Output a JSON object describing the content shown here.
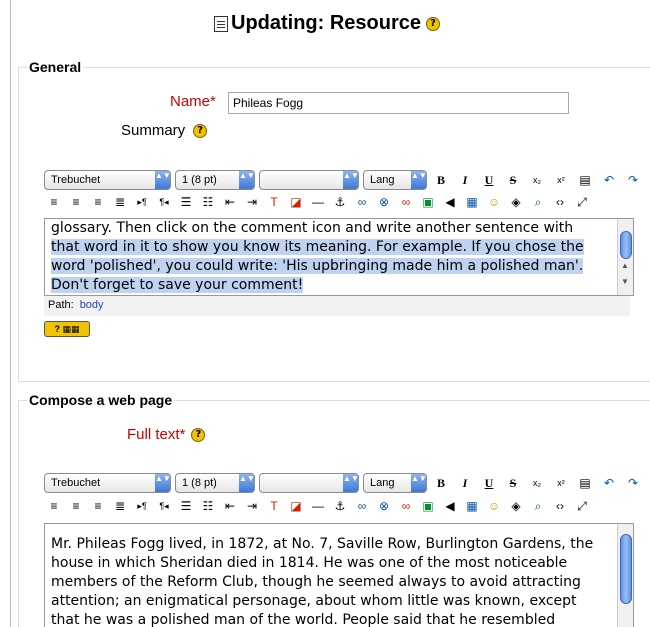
{
  "page": {
    "title": "Updating: Resource",
    "title_icon": "document-icon",
    "help_glyph": "?"
  },
  "general": {
    "legend": "General",
    "name_label": "Name",
    "required_mark": "*",
    "name_value": "Phileas Fogg",
    "summary_label": "Summary",
    "editor_text_plain": "glossary. Then click on the comment icon and write another sentence with",
    "editor_text_selected": [
      "that word in it to show you know its meaning. For example. If you chose the",
      "word 'polished', you could write: 'His upbringing made him a polished man'.",
      "Don't forget to save your comment!"
    ],
    "path_label": "Path:",
    "path_value": "body",
    "keyboard_help_icon": "keyboard-help-icon"
  },
  "compose": {
    "legend": "Compose a web page",
    "full_text_label": "Full text",
    "required_mark": "*",
    "editor_lines": [
      "Mr. Phileas Fogg lived, in 1872, at No. 7, Saville Row, Burlington Gardens, the",
      "house in which Sheridan died in 1814. He was one of the most noticeable",
      "members of the Reform Club, though he seemed always to avoid attracting",
      "attention; an enigmatical personage, about whom little was known, except",
      "that he was a polished man of the world. People said that he resembled"
    ]
  },
  "toolbar": {
    "font": "Trebuchet",
    "size": "1 (8 pt)",
    "style": "",
    "lang": "Lang",
    "bold": "B",
    "italic": "I",
    "underline": "U",
    "strike": "S",
    "subscript": "x₂",
    "superscript": "x²",
    "arrow_glyph": "▲▼",
    "row2_icons": [
      "align-left-icon",
      "align-center-icon",
      "align-right-icon",
      "align-justify-icon",
      "ltr-icon",
      "rtl-icon",
      "ordered-list-icon",
      "unordered-list-icon",
      "outdent-icon",
      "indent-icon",
      "text-color-icon",
      "background-color-icon",
      "horizontal-rule-icon",
      "anchor-icon",
      "link-icon",
      "unlink-icon",
      "nolink-icon",
      "image-icon",
      "media-icon",
      "table-icon",
      "smiley-icon",
      "special-char-icon",
      "search-replace-icon",
      "html-source-icon",
      "fullscreen-icon"
    ]
  },
  "colors": {
    "required": "#cc0000",
    "selection": "#bdd3f0",
    "help_icon": "#f2c400",
    "path_link": "#2244bb"
  }
}
